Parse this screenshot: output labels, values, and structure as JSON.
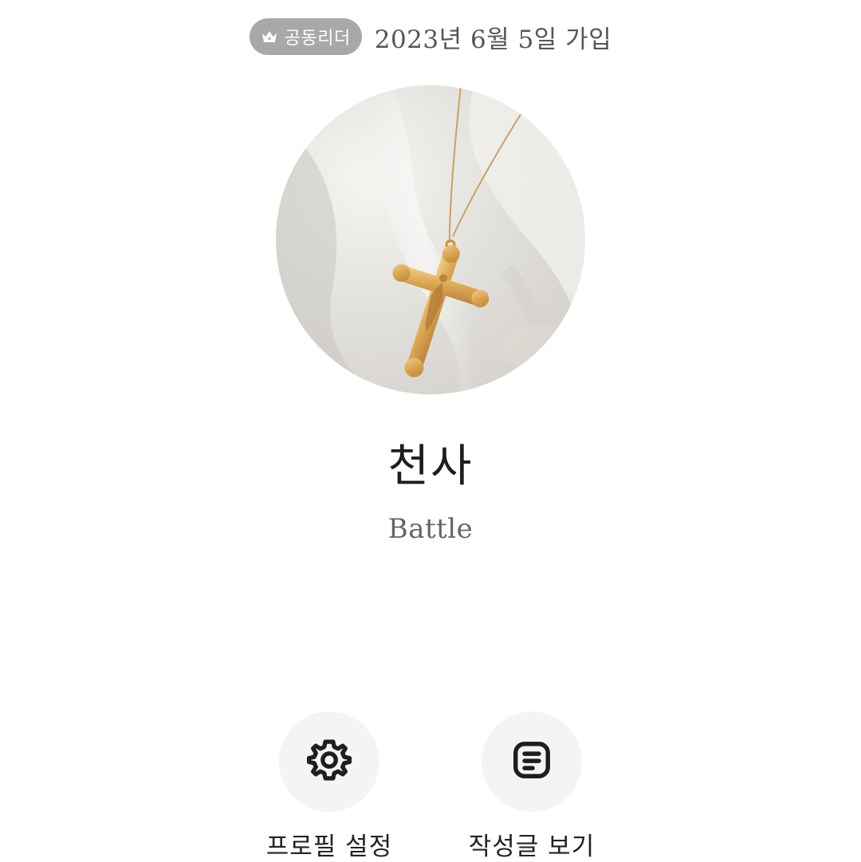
{
  "header": {
    "role_badge": "공동리더",
    "role_icon": "crown-icon",
    "join_date": "2023년 6월 5일 가입"
  },
  "profile": {
    "avatar_alt": "gold crucifix necklace on white fabric",
    "nickname": "천사",
    "status_message": "Battle"
  },
  "actions": [
    {
      "label": "프로필 설정",
      "icon": "gear-icon"
    },
    {
      "label": "작성글 보기",
      "icon": "document-list-icon"
    }
  ],
  "colors": {
    "badge_bg": "#a8a8a8",
    "button_bg": "#f3f4f6",
    "text_primary": "#1e1e1e",
    "text_secondary": "#666666"
  }
}
